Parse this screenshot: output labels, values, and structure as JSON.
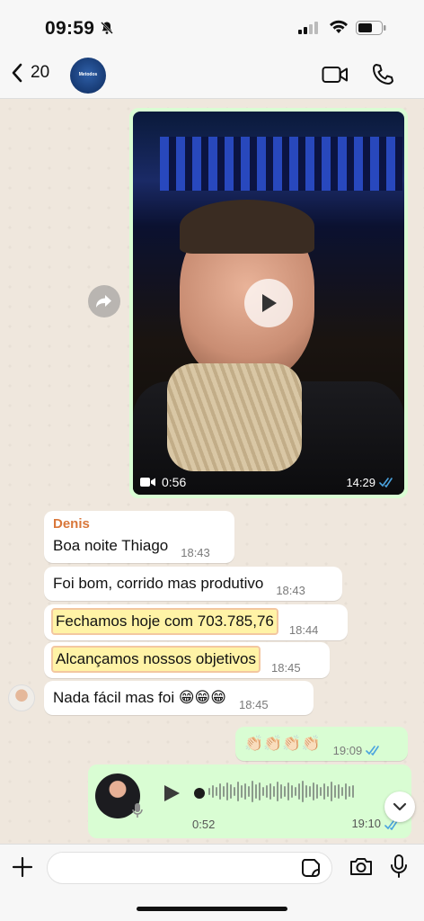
{
  "status_bar": {
    "time": "09:59"
  },
  "header": {
    "back_count": "20",
    "contact_avatar_text": "Metodos"
  },
  "video_message": {
    "duration": "0:56",
    "time": "14:29"
  },
  "messages": [
    {
      "sender": "Denis",
      "text": "Boa noite Thiago",
      "time": "18:43"
    },
    {
      "text": "Foi bom, corrido mas produtivo",
      "time": "18:43"
    },
    {
      "text": "Fechamos hoje com 703.785,76",
      "time": "18:44"
    },
    {
      "text": "Alcançamos nossos objetivos",
      "time": "18:45"
    },
    {
      "text": "Nada fácil mas foi 😁😁😁",
      "time": "18:45"
    }
  ],
  "outgoing_emoji": {
    "text": "👏🏻👏🏻👏🏻👏🏻",
    "time": "19:09"
  },
  "voice_message": {
    "duration": "0:52",
    "time": "19:10"
  },
  "colors": {
    "incoming": "#ffffff",
    "outgoing": "#d9fdd3",
    "sender": "#d9773a",
    "read_checks": "#4aa3df"
  }
}
